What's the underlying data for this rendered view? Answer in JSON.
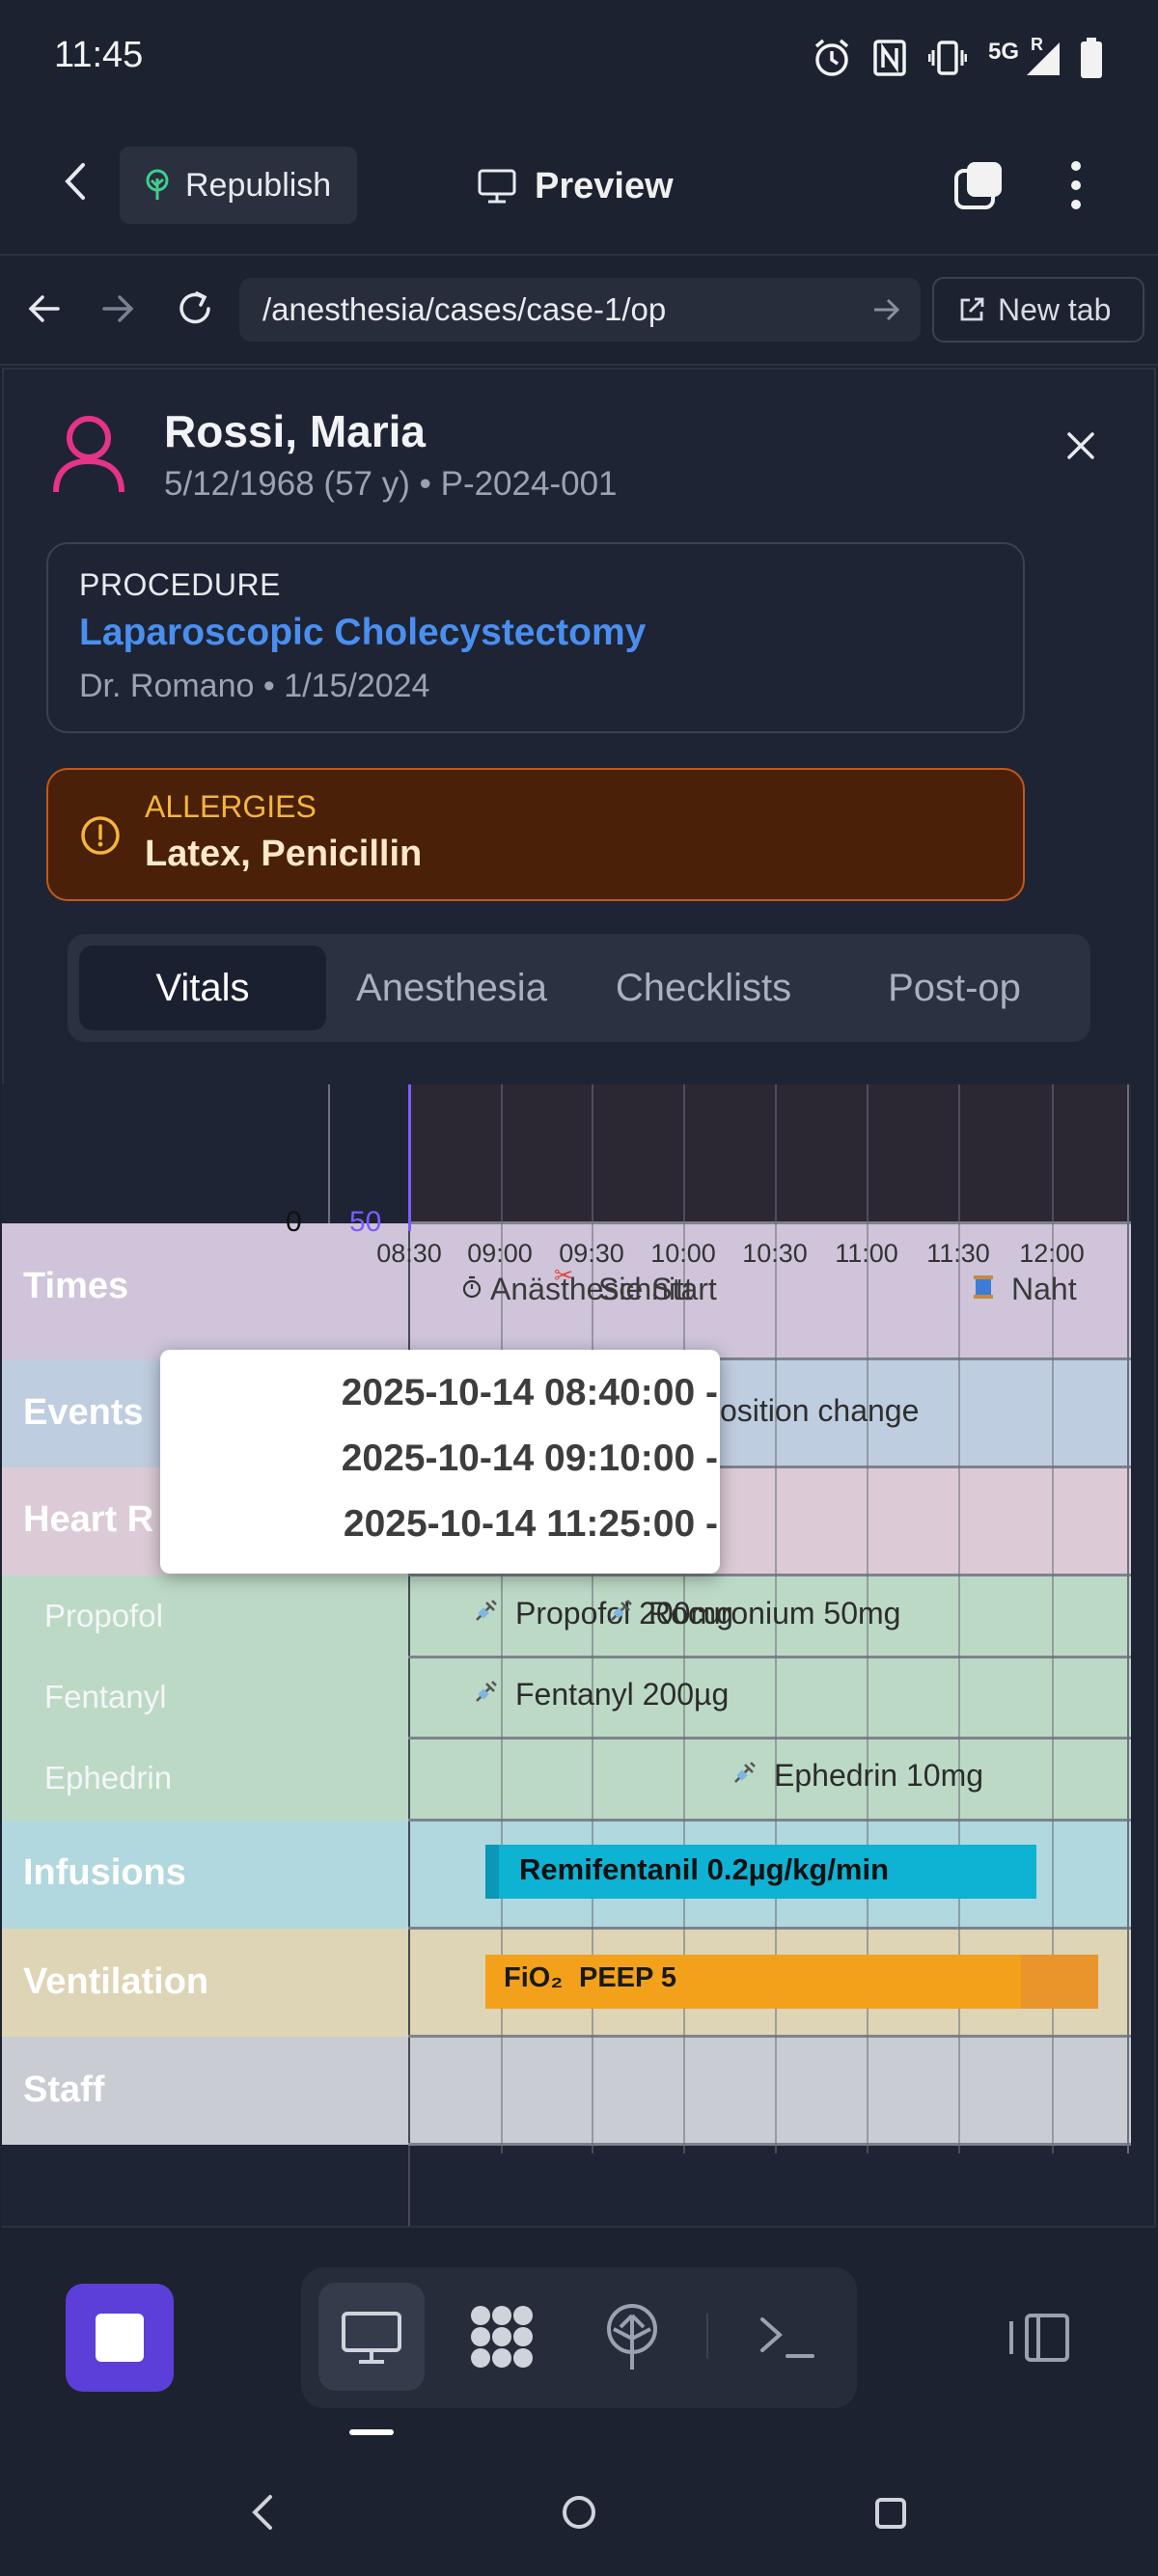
{
  "status_bar": {
    "time": "11:45",
    "signal_label": "5G",
    "roaming_label": "R",
    "icons": [
      "alarm-icon",
      "nfc-icon",
      "vibrate-icon",
      "signal-icon",
      "battery-icon"
    ]
  },
  "app_toolbar": {
    "republish_label": "Republish",
    "preview_label": "Preview"
  },
  "browser": {
    "url": "/anesthesia/cases/case-1/op",
    "new_tab_label": "New tab"
  },
  "patient": {
    "name": "Rossi, Maria",
    "meta": "5/12/1968 (57 y) • P-2024-001"
  },
  "procedure": {
    "label": "PROCEDURE",
    "name": "Laparoscopic Cholecystectomy",
    "meta": "Dr. Romano • 1/15/2024"
  },
  "allergies": {
    "label": "ALLERGIES",
    "value": "Latex, Penicillin"
  },
  "tabs": [
    {
      "label": "Vitals",
      "active": true
    },
    {
      "label": "Anesthesia",
      "active": false
    },
    {
      "label": "Checklists",
      "active": false
    },
    {
      "label": "Post-op",
      "active": false
    }
  ],
  "timeline": {
    "y_axis": {
      "left": "0",
      "right": "50"
    },
    "ticks": [
      "08:30",
      "09:00",
      "09:30",
      "10:00",
      "10:30",
      "11:00",
      "11:30",
      "12:00"
    ],
    "lanes": {
      "times": "Times",
      "events": "Events",
      "heart_rate": "Heart R",
      "propofol": "Propofol",
      "fentanyl": "Fentanyl",
      "ephedrin": "Ephedrin",
      "infusions": "Infusions",
      "ventilation": "Ventilation",
      "staff": "Staff"
    },
    "times_events": {
      "anesthesia_start": "Anästhesie Start",
      "schnitt": "Schnitt",
      "scissor_mark": "✂",
      "naht": "Naht"
    },
    "events_text": "osition change",
    "drugs": {
      "propofol": "Propofol 200mg",
      "rocuronium": "Rocuronium 50mg",
      "fentanyl": "Fentanyl 200µg",
      "ephedrin": "Ephedrin 10mg"
    },
    "infusion_bar": "Remifentanil 0.2µg/kg/min",
    "ventilation_bar": {
      "fio2": "FiO₂",
      "peep": "PEEP 5"
    },
    "tooltip_lines": [
      "2025-10-14 08:40:00 -",
      "2025-10-14 09:10:00 -",
      "2025-10-14 11:25:00 -"
    ]
  },
  "colors": {
    "lane_times": "#cfc4d9",
    "lane_events": "#bfcde0",
    "lane_heart": "#dccbd6",
    "lane_drugs": "#bcd9c6",
    "lane_infusions": "#b0d8de",
    "lane_ventilation": "#ddd5b6",
    "lane_staff": "#c9ccd2",
    "infusion_bar": "#0eb2d3",
    "ventilation_bar": "#f3a11b",
    "accent_purple": "#5b3fd8"
  }
}
